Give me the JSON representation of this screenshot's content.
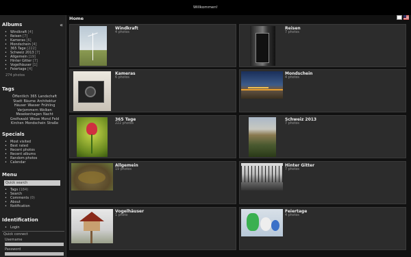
{
  "header": {
    "welcome": "Willkommen!"
  },
  "sidebar": {
    "collapse_icon": "«",
    "albums": {
      "title": "Albums",
      "items": [
        {
          "label": "Windkraft",
          "count": "[4]"
        },
        {
          "label": "Reisen",
          "count": "[7]"
        },
        {
          "label": "Kameras",
          "count": "[6]"
        },
        {
          "label": "Mondschein",
          "count": "[4]"
        },
        {
          "label": "365 Tage",
          "count": "[222]"
        },
        {
          "label": "Schweiz 2013",
          "count": "[7]"
        },
        {
          "label": "Allgemein",
          "count": "[19]"
        },
        {
          "label": "Hinter Gitter",
          "count": "[7]"
        },
        {
          "label": "Vogelhäuser",
          "count": "[1]"
        },
        {
          "label": "Feiertage",
          "count": "[4]"
        }
      ],
      "total": "274 photos"
    },
    "tags": {
      "title": "Tags",
      "lines": [
        [
          "Öffentlich",
          "365",
          "Landschaft"
        ],
        [
          "Stadt",
          "Bäume",
          "Architektur"
        ],
        [
          "Häuser",
          "Wasser",
          "Frühling"
        ],
        [
          "Verjommern",
          "Wolken"
        ],
        [
          "Mesekenhagen",
          "Nacht"
        ],
        [
          "Greifswald",
          "Wiese",
          "Mond",
          "Feld"
        ],
        [
          "Kirchen",
          "Mondschein",
          "Straße"
        ]
      ]
    },
    "specials": {
      "title": "Specials",
      "items": [
        "Most visited",
        "Best rated",
        "Recent photos",
        "Recent albums",
        "Random photos",
        "Calendar"
      ]
    },
    "menu": {
      "title": "Menu",
      "search_placeholder": "Quick search",
      "items": [
        {
          "label": "Tags",
          "count": "(184)"
        },
        {
          "label": "Search",
          "count": ""
        },
        {
          "label": "Comments",
          "count": "(0)"
        },
        {
          "label": "About",
          "count": ""
        },
        {
          "label": "Notification",
          "count": ""
        }
      ]
    },
    "identification": {
      "title": "Identification",
      "login": "Login",
      "quick_connect": "Quick connect",
      "username_label": "Username",
      "password_label": "Password"
    }
  },
  "main": {
    "title": "Home",
    "flags": [
      "flag-de-icon",
      "flag-us-icon"
    ],
    "albums": [
      {
        "name": "Windkraft",
        "desc": "4 photos",
        "thumb": "wind-turbine-photo"
      },
      {
        "name": "Reisen",
        "desc": "7 photos",
        "thumb": "dark-doorway-photo"
      },
      {
        "name": "Kameras",
        "desc": "6 photos",
        "thumb": "vintage-camera-photo"
      },
      {
        "name": "Mondschein",
        "desc": "4 photos",
        "thumb": "night-street-photo"
      },
      {
        "name": "365 Tage",
        "desc": "222 photos",
        "thumb": "red-tulip-photo"
      },
      {
        "name": "Schweiz 2013",
        "desc": "7 photos",
        "thumb": "mountain-forest-photo"
      },
      {
        "name": "Allgemein",
        "desc": "19 photos",
        "thumb": "garden-bed-photo"
      },
      {
        "name": "Hinter Gitter",
        "desc": "7 photos",
        "thumb": "fence-bw-photo"
      },
      {
        "name": "Vogelhäuser",
        "desc": "1 photo",
        "thumb": "birdhouse-photo"
      },
      {
        "name": "Feiertage",
        "desc": "4 photos",
        "thumb": "easter-decoration-photo"
      }
    ]
  }
}
